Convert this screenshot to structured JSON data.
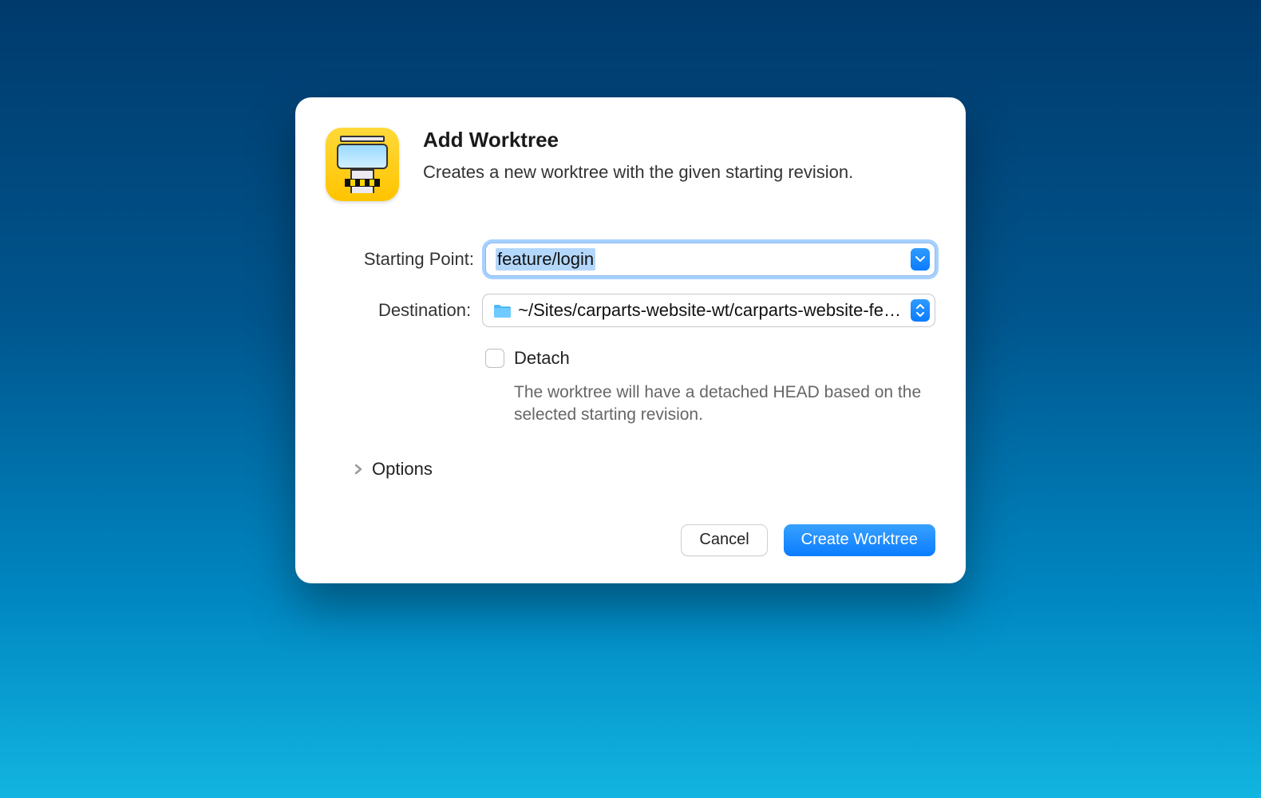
{
  "dialog": {
    "title": "Add Worktree",
    "subtitle": "Creates a new worktree with the given starting revision.",
    "fields": {
      "starting_point": {
        "label": "Starting Point:",
        "value": "feature/login"
      },
      "destination": {
        "label": "Destination:",
        "path": "~/Sites/carparts-website-wt/carparts-website-fe…"
      },
      "detach": {
        "label": "Detach",
        "checked": false,
        "helper": "The worktree will have a detached HEAD based on the selected starting revision."
      }
    },
    "options_label": "Options",
    "buttons": {
      "cancel": "Cancel",
      "create": "Create Worktree"
    },
    "colors": {
      "accent": "#0a7cff"
    }
  }
}
